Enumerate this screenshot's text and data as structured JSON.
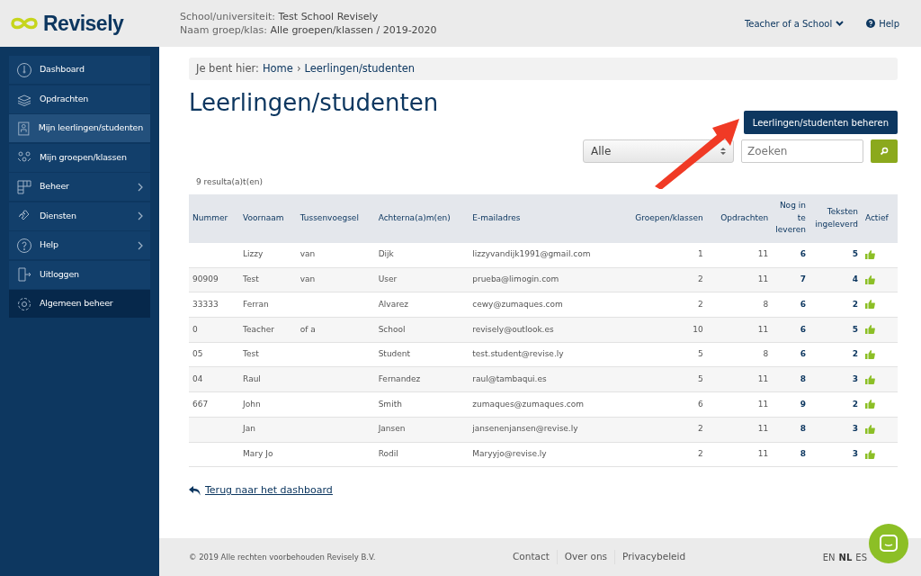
{
  "header": {
    "logo": "Revisely",
    "school_label": "School/universiteit:",
    "school": "Test School Revisely",
    "group_label": "Naam groep/klas:",
    "group": "Alle groepen/klassen / 2019-2020",
    "user_menu": "Teacher of a School",
    "help": "Help"
  },
  "sidebar": {
    "items": [
      {
        "label": "Dashboard",
        "selected": false,
        "submenu": false,
        "kind": "nav"
      },
      {
        "label": "Opdrachten",
        "selected": false,
        "submenu": false,
        "kind": "nav"
      },
      {
        "label": "Mijn leerlingen/studenten",
        "selected": true,
        "submenu": false,
        "kind": "nav"
      },
      {
        "label": "Mijn groepen/klassen",
        "selected": false,
        "submenu": false,
        "kind": "nav"
      },
      {
        "label": "Beheer",
        "selected": false,
        "submenu": true,
        "kind": "nav"
      },
      {
        "label": "Diensten",
        "selected": false,
        "submenu": true,
        "kind": "nav"
      },
      {
        "label": "Help",
        "selected": false,
        "submenu": true,
        "kind": "nav"
      },
      {
        "label": "Uitloggen",
        "selected": false,
        "submenu": false,
        "kind": "nav"
      },
      {
        "label": "Algemeen beheer",
        "selected": false,
        "submenu": false,
        "kind": "admin"
      }
    ]
  },
  "breadcrumb": {
    "prefix": "Je bent hier:",
    "separator": "›",
    "items": [
      "Home",
      "Leerlingen/studenten"
    ]
  },
  "page_title": "Leerlingen/studenten",
  "manage_button": "Leerlingen/studenten beheren",
  "filter": {
    "value": "Alle"
  },
  "search": {
    "placeholder": "Zoeken"
  },
  "results": "9 resulta(a)t(en)",
  "table": {
    "columns": [
      "Nummer",
      "Voornaam",
      "Tussenvoegsel",
      "Achterna(a)m(en)",
      "E-mailadres",
      "Groepen/klassen",
      "Opdrachten",
      "Nog in te leveren",
      "Teksten ingeleverd",
      "Actief"
    ],
    "rows": [
      {
        "cells": [
          "",
          "Lizzy",
          "van",
          "Dijk",
          "lizzyvandijk1991@gmail.com",
          "1",
          "11",
          "6",
          "5"
        ],
        "active": true
      },
      {
        "cells": [
          "90909",
          "Test",
          "van",
          "User",
          "prueba@limogin.com",
          "2",
          "11",
          "7",
          "4"
        ],
        "active": true
      },
      {
        "cells": [
          "33333",
          "Ferran",
          "",
          "Alvarez",
          "cewy@zumaques.com",
          "2",
          "8",
          "6",
          "2"
        ],
        "active": true
      },
      {
        "cells": [
          "0",
          "Teacher",
          "of a",
          "School",
          "revisely@outlook.es",
          "10",
          "11",
          "6",
          "5"
        ],
        "active": true
      },
      {
        "cells": [
          "05",
          "Test",
          "",
          "Student",
          "test.student@revise.ly",
          "5",
          "8",
          "6",
          "2"
        ],
        "active": true
      },
      {
        "cells": [
          "04",
          "Raul",
          "",
          "Fernandez",
          "raul@tambaqui.es",
          "5",
          "11",
          "8",
          "3"
        ],
        "active": true
      },
      {
        "cells": [
          "667",
          "John",
          "",
          "Smith",
          "zumaques@zumaques.com",
          "6",
          "11",
          "9",
          "2"
        ],
        "active": true
      },
      {
        "cells": [
          "",
          "Jan",
          "",
          "Jansen",
          "jansenenjansen@revise.ly",
          "2",
          "11",
          "8",
          "3"
        ],
        "active": true
      },
      {
        "cells": [
          "",
          "Mary Jo",
          "",
          "Rodil",
          "Maryyjo@revise.ly",
          "2",
          "11",
          "8",
          "3"
        ],
        "active": true
      }
    ]
  },
  "back_link": "Terug naar het dashboard",
  "footer": {
    "copyright": "© 2019 Alle rechten voorbehouden Revisely B.V.",
    "links": [
      "Contact",
      "Over ons",
      "Privacybeleid"
    ],
    "languages": [
      {
        "label": "EN",
        "selected": false
      },
      {
        "label": "NL",
        "selected": true
      },
      {
        "label": "ES",
        "selected": false
      }
    ]
  }
}
